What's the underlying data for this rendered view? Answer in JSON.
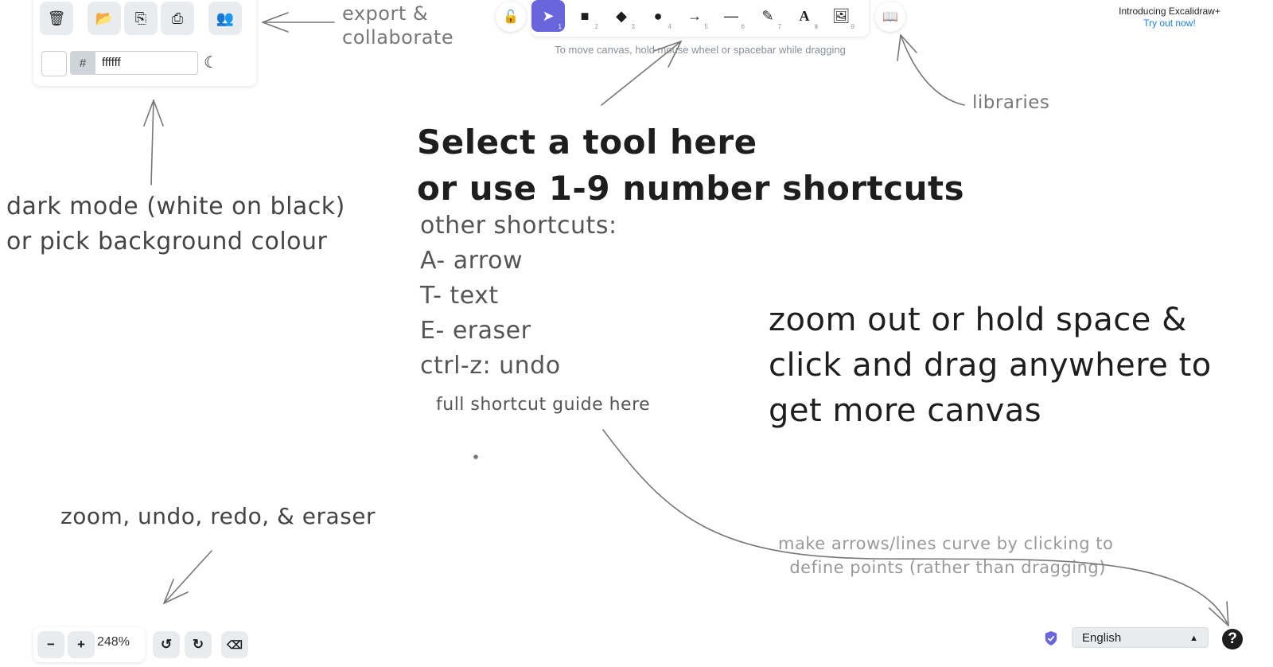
{
  "left_panel": {
    "buttons": [
      {
        "name": "clear-canvas",
        "icon": "trash-icon",
        "glyph": "🗑"
      },
      {
        "name": "open",
        "icon": "folder-open-icon",
        "glyph": "📂"
      },
      {
        "name": "save",
        "icon": "save-file-icon",
        "glyph": "⎘"
      },
      {
        "name": "export-image",
        "icon": "export-image-icon",
        "glyph": "⎙"
      },
      {
        "name": "collaborate",
        "icon": "users-icon",
        "glyph": "👥"
      }
    ],
    "background_hash": "#",
    "background_value": "ffffff",
    "dark_mode_icon": "☾"
  },
  "toolbar": {
    "lock_glyph": "🔓",
    "tools": [
      {
        "name": "selection",
        "icon": "cursor-icon",
        "glyph": "➤",
        "shortcut": "1",
        "active": true
      },
      {
        "name": "rectangle",
        "icon": "square-icon",
        "glyph": "■",
        "shortcut": "2",
        "active": false
      },
      {
        "name": "diamond",
        "icon": "diamond-icon",
        "glyph": "◆",
        "shortcut": "3",
        "active": false
      },
      {
        "name": "ellipse",
        "icon": "circle-icon",
        "glyph": "●",
        "shortcut": "4",
        "active": false
      },
      {
        "name": "arrow",
        "icon": "arrow-right-icon",
        "glyph": "→",
        "shortcut": "5",
        "active": false
      },
      {
        "name": "line",
        "icon": "line-icon",
        "glyph": "—",
        "shortcut": "6",
        "active": false
      },
      {
        "name": "draw",
        "icon": "pencil-icon",
        "glyph": "✎",
        "shortcut": "7",
        "active": false
      },
      {
        "name": "text",
        "icon": "text-icon",
        "glyph": "A",
        "shortcut": "8",
        "active": false
      },
      {
        "name": "image",
        "icon": "image-icon",
        "glyph": "🖼",
        "shortcut": "9",
        "active": false
      }
    ],
    "library_glyph": "📖",
    "hint": "To move canvas, hold mouse wheel or spacebar while dragging"
  },
  "promo": {
    "title": "Introducing Excalidraw+",
    "link": "Try out now!"
  },
  "canvas_notes": {
    "export": "export &\ncollaborate",
    "libraries": "libraries",
    "dark_mode": "dark mode (white on black)\nor pick background colour",
    "select_tool": "Select a tool here\nor use 1-9 number shortcuts",
    "other_shortcuts": "other shortcuts:\nA- arrow\nT- text\nE- eraser\nctrl-z: undo",
    "shortcut_guide": "full shortcut guide here",
    "zoom_hint": "zoom out or hold space &\nclick and drag anywhere to\nget more canvas",
    "footer_tools": "zoom, undo, redo, & eraser",
    "curve_hint": "make arrows/lines curve by clicking to\n  define points (rather than dragging)"
  },
  "footer": {
    "zoom_out": "−",
    "zoom_in": "+",
    "zoom_level": "248%",
    "undo_glyph": "↺",
    "redo_glyph": "↻",
    "eraser_glyph": "⌫",
    "language": "English",
    "language_caret": "▲",
    "help_glyph": "?"
  },
  "colors": {
    "accent": "#6965db",
    "link": "#1c7ed6"
  }
}
